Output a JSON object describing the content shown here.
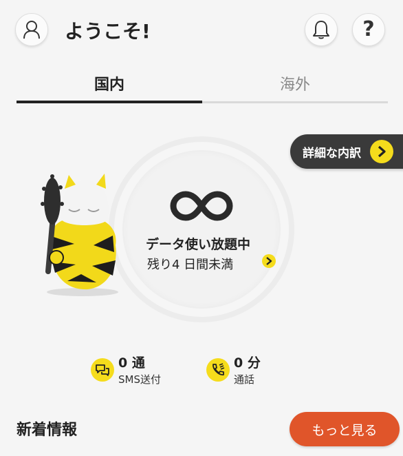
{
  "header": {
    "welcome": "ようこそ!",
    "help_label": "?",
    "icons": [
      "person-icon",
      "bell-icon",
      "question-icon"
    ]
  },
  "tabs": [
    {
      "label": "国内",
      "active": true
    },
    {
      "label": "海外",
      "active": false
    }
  ],
  "detail_button": {
    "label": "詳細な内訳",
    "icon": "chevron-right-icon"
  },
  "data_status": {
    "icon": "infinity-icon",
    "title": "データ使い放題中",
    "remaining": "残り4 日間未満"
  },
  "stats": [
    {
      "value": "0 通",
      "label": "SMS送付",
      "icon": "sms-icon"
    },
    {
      "value": "0 分",
      "label": "通話",
      "icon": "phone-icon"
    }
  ],
  "news": {
    "title": "新着情報",
    "more_label": "もっと見る"
  },
  "colors": {
    "accent_yellow": "#f5dc1c",
    "button_orange": "#e0552a",
    "dark": "#3a3a3a"
  }
}
